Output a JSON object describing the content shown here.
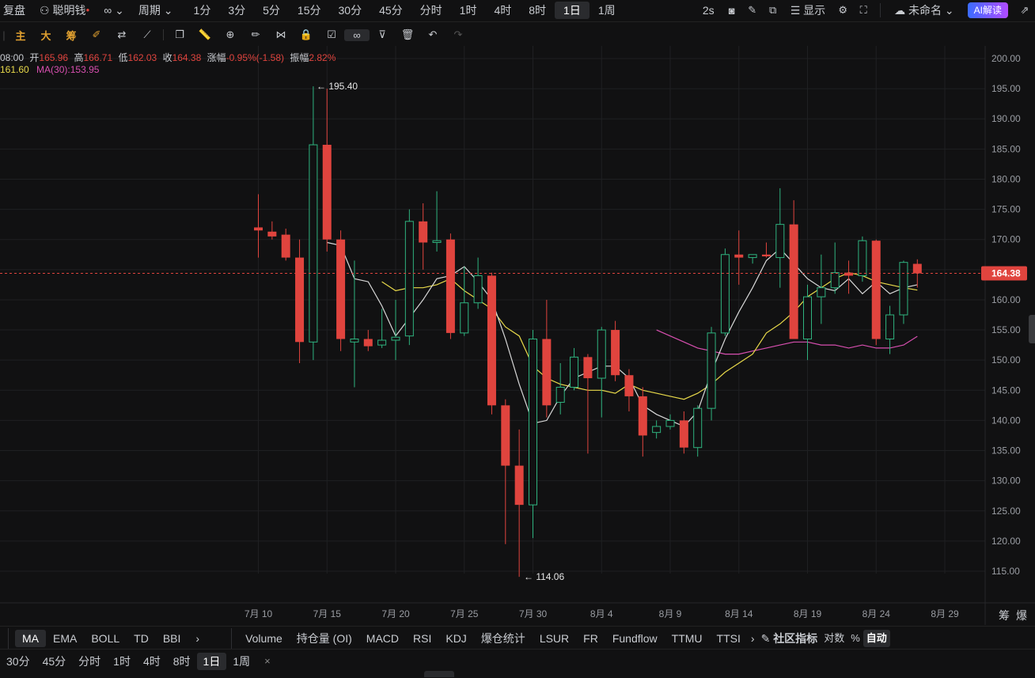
{
  "topbar": {
    "left": [
      "复盘",
      "聪明钱",
      "周期"
    ],
    "periods": [
      "1分",
      "3分",
      "5分",
      "15分",
      "30分",
      "45分",
      "分时",
      "1时",
      "4时",
      "8时",
      "1日",
      "1周"
    ],
    "active_period": "1日",
    "right": {
      "refresh": "2s",
      "display": "显示",
      "layout_name": "未命名",
      "ai": "AI解读"
    }
  },
  "toolbar2": {
    "labels": [
      "主",
      "大",
      "筹"
    ]
  },
  "ohlc": {
    "time": "08:00",
    "open_label": "开",
    "open": "165.96",
    "high_label": "高",
    "high": "166.71",
    "low_label": "低",
    "low": "162.03",
    "close_label": "收",
    "close": "164.38",
    "change_label": "涨幅",
    "change": "-0.95%(-1.58)",
    "amp_label": "振幅",
    "amp": "2.82%"
  },
  "ma_info": {
    "ma_a": "161.60",
    "ma30": "MA(30):153.95"
  },
  "colors": {
    "up": "#2fb37f",
    "down": "#e0443e",
    "ma_yellow": "#e8d94a",
    "ma_white": "#d8d8d8",
    "ma_pink": "#d84fb0",
    "bg": "#111112"
  },
  "chart_data": {
    "type": "candlestick",
    "y_axis_ticks": [
      200,
      195,
      190,
      185,
      180,
      175,
      170,
      165,
      160,
      155,
      150,
      145,
      140,
      135,
      130,
      125,
      120,
      115
    ],
    "x_axis_labels": [
      "7月 10",
      "7月 15",
      "7月 20",
      "7月 25",
      "7月 30",
      "8月 4",
      "8月 9",
      "8月 14",
      "8月 19",
      "8月 24",
      "8月 29"
    ],
    "current_price": "164.38",
    "high_marker": "← 195.40",
    "low_marker": "← 114.06",
    "candles": [
      {
        "o": 172.0,
        "h": 177.5,
        "l": 167.0,
        "c": 171.5
      },
      {
        "o": 171.3,
        "h": 173.0,
        "l": 170.0,
        "c": 170.5
      },
      {
        "o": 170.8,
        "h": 171.8,
        "l": 166.5,
        "c": 167.0
      },
      {
        "o": 167.0,
        "h": 170.0,
        "l": 149.5,
        "c": 153.0
      },
      {
        "o": 153.0,
        "h": 195.4,
        "l": 150.0,
        "c": 185.7
      },
      {
        "o": 185.7,
        "h": 195.0,
        "l": 168.0,
        "c": 170.0
      },
      {
        "o": 170.0,
        "h": 171.5,
        "l": 151.5,
        "c": 153.5
      },
      {
        "o": 153.0,
        "h": 166.5,
        "l": 145.5,
        "c": 153.5
      },
      {
        "o": 153.5,
        "h": 155.0,
        "l": 151.5,
        "c": 152.3
      },
      {
        "o": 152.5,
        "h": 158.5,
        "l": 152.0,
        "c": 153.3
      },
      {
        "o": 153.3,
        "h": 160.0,
        "l": 150.0,
        "c": 153.8
      },
      {
        "o": 154.0,
        "h": 175.0,
        "l": 152.5,
        "c": 173.0
      },
      {
        "o": 173.0,
        "h": 176.0,
        "l": 165.0,
        "c": 169.5
      },
      {
        "o": 169.5,
        "h": 178.0,
        "l": 168.0,
        "c": 169.8
      },
      {
        "o": 170.0,
        "h": 171.0,
        "l": 153.5,
        "c": 154.5
      },
      {
        "o": 154.5,
        "h": 165.5,
        "l": 154.0,
        "c": 159.5
      },
      {
        "o": 159.5,
        "h": 167.0,
        "l": 158.5,
        "c": 164.0
      },
      {
        "o": 164.0,
        "h": 164.5,
        "l": 141.0,
        "c": 142.5
      },
      {
        "o": 142.5,
        "h": 143.5,
        "l": 119.5,
        "c": 132.5
      },
      {
        "o": 132.5,
        "h": 138.5,
        "l": 114.06,
        "c": 126.0
      },
      {
        "o": 126.0,
        "h": 155.0,
        "l": 120.5,
        "c": 153.5
      },
      {
        "o": 153.5,
        "h": 160.0,
        "l": 140.5,
        "c": 142.5
      },
      {
        "o": 143.0,
        "h": 149.5,
        "l": 141.0,
        "c": 145.5
      },
      {
        "o": 145.5,
        "h": 152.0,
        "l": 145.0,
        "c": 150.5
      },
      {
        "o": 150.5,
        "h": 151.0,
        "l": 134.5,
        "c": 147.0
      },
      {
        "o": 147.0,
        "h": 155.5,
        "l": 140.5,
        "c": 155.0
      },
      {
        "o": 155.0,
        "h": 156.5,
        "l": 146.5,
        "c": 147.5
      },
      {
        "o": 147.5,
        "h": 148.5,
        "l": 141.5,
        "c": 144.0
      },
      {
        "o": 144.0,
        "h": 145.5,
        "l": 134.0,
        "c": 137.5
      },
      {
        "o": 138.0,
        "h": 140.0,
        "l": 137.0,
        "c": 139.0
      },
      {
        "o": 139.0,
        "h": 141.0,
        "l": 138.5,
        "c": 140.0
      },
      {
        "o": 140.0,
        "h": 141.5,
        "l": 134.5,
        "c": 135.5
      },
      {
        "o": 135.5,
        "h": 142.5,
        "l": 134.0,
        "c": 142.0
      },
      {
        "o": 142.0,
        "h": 155.5,
        "l": 140.0,
        "c": 154.5
      },
      {
        "o": 154.5,
        "h": 168.5,
        "l": 154.0,
        "c": 167.5
      },
      {
        "o": 167.5,
        "h": 171.5,
        "l": 162.5,
        "c": 167.0
      },
      {
        "o": 167.0,
        "h": 167.5,
        "l": 166.0,
        "c": 167.5
      },
      {
        "o": 167.5,
        "h": 169.5,
        "l": 167.0,
        "c": 167.2
      },
      {
        "o": 167.0,
        "h": 178.5,
        "l": 162.0,
        "c": 172.5
      },
      {
        "o": 172.5,
        "h": 176.5,
        "l": 153.5,
        "c": 153.5
      },
      {
        "o": 153.5,
        "h": 162.5,
        "l": 150.0,
        "c": 160.5
      },
      {
        "o": 160.5,
        "h": 167.5,
        "l": 156.0,
        "c": 162.0
      },
      {
        "o": 162.0,
        "h": 169.5,
        "l": 161.0,
        "c": 164.5
      },
      {
        "o": 164.5,
        "h": 166.5,
        "l": 161.0,
        "c": 164.0
      },
      {
        "o": 164.0,
        "h": 170.5,
        "l": 163.0,
        "c": 169.8
      },
      {
        "o": 169.8,
        "h": 170.0,
        "l": 152.5,
        "c": 153.5
      },
      {
        "o": 153.5,
        "h": 159.0,
        "l": 151.0,
        "c": 157.5
      },
      {
        "o": 157.5,
        "h": 166.5,
        "l": 156.0,
        "c": 166.2
      },
      {
        "o": 165.96,
        "h": 166.71,
        "l": 162.03,
        "c": 164.38
      }
    ],
    "ma_white": [
      null,
      null,
      null,
      null,
      null,
      169.5,
      169.0,
      163.5,
      163.0,
      159.0,
      154.0,
      157.0,
      160.0,
      163.5,
      164.0,
      165.5,
      163.0,
      160.0,
      153.5,
      146.0,
      139.5,
      140.0,
      144.0,
      147.0,
      148.0,
      149.0,
      149.0,
      147.0,
      142.5,
      141.0,
      140.0,
      139.0,
      141.5,
      148.0,
      153.5,
      158.0,
      162.0,
      166.5,
      168.5,
      166.0,
      163.5,
      162.0,
      161.5,
      163.5,
      161.0,
      163.0,
      161.0,
      162.0,
      162.5
    ],
    "ma_yellow": [
      null,
      null,
      null,
      null,
      null,
      null,
      null,
      null,
      null,
      163.0,
      161.5,
      162.0,
      162.0,
      162.5,
      163.5,
      161.5,
      160.0,
      158.5,
      155.5,
      154.0,
      149.0,
      147.0,
      146.0,
      145.5,
      145.0,
      145.0,
      144.5,
      146.0,
      145.0,
      144.5,
      144.0,
      143.5,
      144.5,
      146.0,
      148.0,
      149.5,
      151.0,
      154.5,
      156.0,
      158.0,
      160.5,
      162.0,
      163.5,
      164.5,
      164.0,
      163.0,
      162.5,
      162.0,
      161.6
    ],
    "ma_pink": [
      null,
      null,
      null,
      null,
      null,
      null,
      null,
      null,
      null,
      null,
      null,
      null,
      null,
      null,
      null,
      null,
      null,
      null,
      null,
      null,
      null,
      null,
      null,
      null,
      null,
      null,
      null,
      null,
      null,
      155.0,
      154.0,
      153.0,
      152.0,
      151.5,
      151.0,
      151.0,
      151.5,
      152.0,
      152.5,
      153.0,
      153.0,
      152.5,
      152.5,
      152.0,
      152.5,
      152.0,
      152.0,
      152.5,
      153.95
    ]
  },
  "bottombar": {
    "main_indicators": [
      "MA",
      "EMA",
      "BOLL",
      "TD",
      "BBI"
    ],
    "active_main": "MA",
    "sub_indicators": [
      "Volume",
      "持仓量 (OI)",
      "MACD",
      "RSI",
      "KDJ",
      "爆仓统计",
      "LSUR",
      "FR",
      "Fundflow",
      "TTMU",
      "TTSI"
    ],
    "community": "社区指标",
    "scale": [
      "对数",
      "%",
      "自动"
    ],
    "right_labels": [
      "筹",
      "爆"
    ]
  },
  "timebar": {
    "items": [
      "30分",
      "45分",
      "分时",
      "1时",
      "4时",
      "8时",
      "1日",
      "1周"
    ],
    "active": "1日",
    "close": "×"
  }
}
